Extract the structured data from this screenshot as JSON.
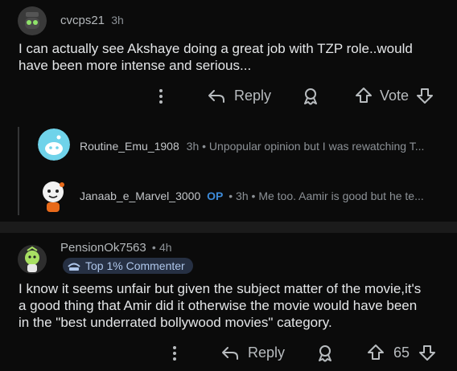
{
  "comment1": {
    "username": "cvcps21",
    "time": "3h",
    "text_line1": "I can actually see Akshaye doing a great job with TZP role..would",
    "text_line2": "have been more intense and serious...",
    "actions": {
      "reply_label": "Reply",
      "vote_label": "Vote"
    }
  },
  "replies": [
    {
      "username": "Routine_Emu_1908",
      "time": "3h",
      "sep": "•",
      "snippet": "Unpopular opinion but I was rewatching T..."
    },
    {
      "username": "Janaab_e_Marvel_3000",
      "op_label": "OP",
      "time": "3h",
      "sep1": "•",
      "sep2": "•",
      "snippet": "Me too. Aamir is good but he te..."
    }
  ],
  "comment2": {
    "username": "PensionOk7563",
    "time": "4h",
    "sep": "•",
    "badge": "Top 1% Commenter",
    "text_line1": "I know it seems unfair but given the subject matter of the movie,it's",
    "text_line2": "a good thing that Amir did it otherwise the movie would have been",
    "text_line3": "in the \"best underrated bollywood movies\" category.",
    "actions": {
      "reply_label": "Reply",
      "vote_count": "65"
    }
  },
  "icons": {
    "more": "more-vertical-icon",
    "reply": "reply-arrow-icon",
    "award": "award-icon",
    "upvote": "upvote-icon",
    "downvote": "downvote-icon"
  },
  "colors": {
    "background": "#0b0b0b",
    "op": "#3d8bd9",
    "badge_bg": "#263043"
  }
}
